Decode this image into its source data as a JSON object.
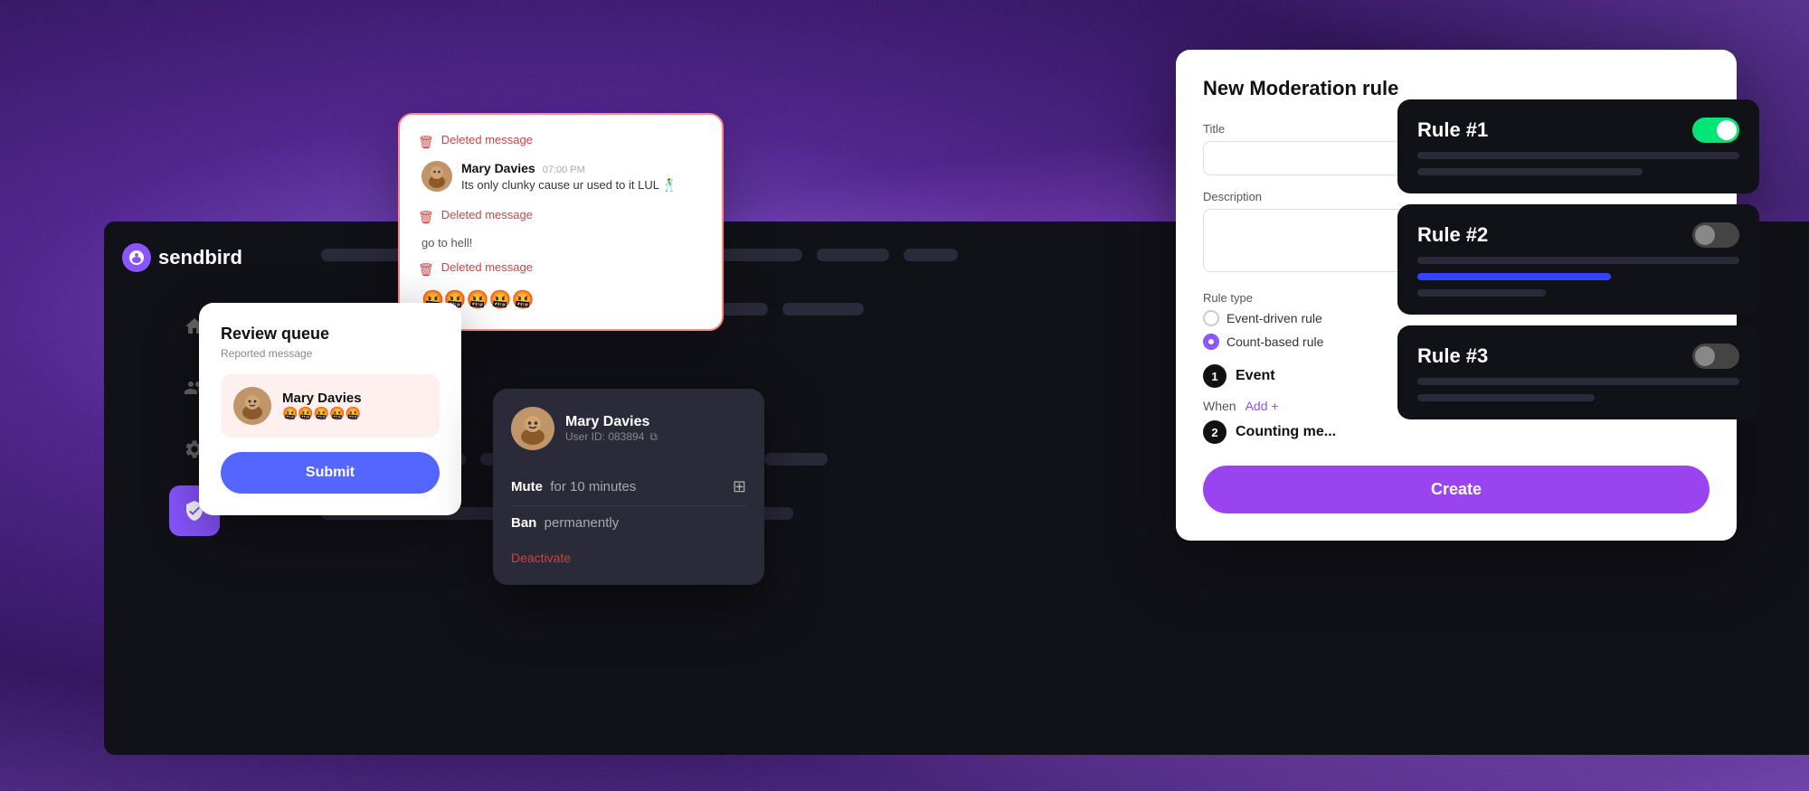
{
  "brand": {
    "name": "sendbird",
    "logo_color": "#8855ff"
  },
  "sidebar": {
    "nav_items": [
      {
        "id": "home",
        "icon": "🏠",
        "label": "Home",
        "active": false
      },
      {
        "id": "users",
        "icon": "👥",
        "label": "Users",
        "active": false
      },
      {
        "id": "settings",
        "icon": "⚙️",
        "label": "Settings",
        "active": false
      },
      {
        "id": "moderation",
        "icon": "🛡️",
        "label": "Moderation",
        "active": true
      }
    ]
  },
  "review_queue": {
    "title": "Review queue",
    "subtitle": "Reported message",
    "reported_user": "Mary Davies",
    "reported_message": "🤬🤬🤬🤬🤬",
    "submit_label": "Submit"
  },
  "deleted_messages": {
    "messages": [
      {
        "type": "deleted",
        "label": "Deleted message"
      },
      {
        "type": "user",
        "name": "Mary Davies",
        "time": "07:00 PM",
        "text": "Its only clunky cause ur used to it LUL 🕺"
      },
      {
        "type": "deleted",
        "label": "Deleted message",
        "text": "go to hell!"
      },
      {
        "type": "deleted",
        "label": "Deleted message",
        "text": "🤬🤬🤬🤬🤬"
      }
    ]
  },
  "user_action": {
    "name": "Mary Davies",
    "user_id": "User ID: 083894",
    "actions": [
      {
        "label": "Mute",
        "detail": "for 10 minutes"
      },
      {
        "label": "Ban",
        "detail": "permanently"
      }
    ],
    "deactivate_label": "Deactivate"
  },
  "moderation_rule": {
    "title": "New Moderation rule",
    "title_label": "Title",
    "description_label": "Description",
    "rule_type_label": "Rule type",
    "rule_types": [
      {
        "label": "Event-driven rule",
        "selected": false
      },
      {
        "label": "Count-based rule",
        "selected": true
      }
    ],
    "steps": [
      {
        "number": "1",
        "label": "Event"
      },
      {
        "number": "2",
        "label": "Counting me..."
      }
    ],
    "when_label": "When",
    "add_label": "Add +",
    "create_label": "Create"
  },
  "rules": [
    {
      "title": "Rule #1",
      "enabled": true
    },
    {
      "title": "Rule #2",
      "enabled": false
    },
    {
      "title": "Rule #3",
      "enabled": false
    }
  ]
}
